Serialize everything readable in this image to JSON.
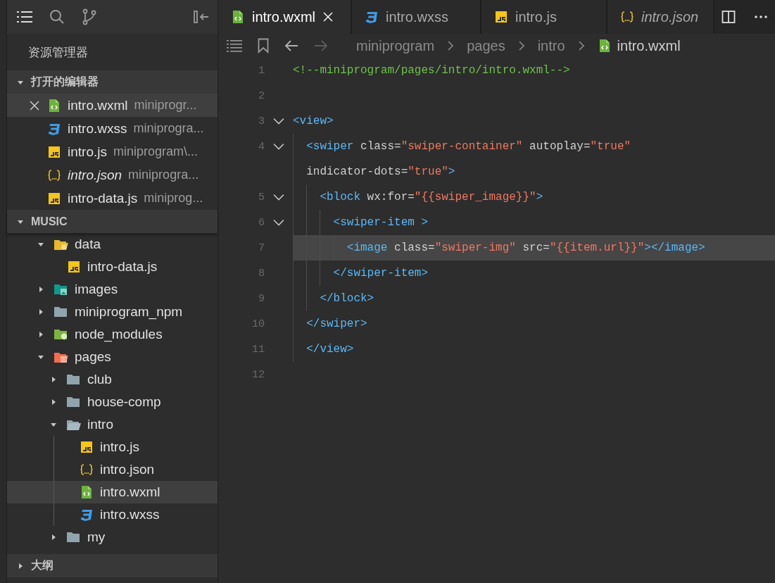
{
  "sidebar": {
    "title": "资源管理器",
    "open_editors": {
      "label": "打开的编辑器",
      "expanded": true,
      "items": [
        {
          "name": "intro.wxml",
          "path": "miniprogr...",
          "kind": "wxml",
          "selected": true,
          "preview": false
        },
        {
          "name": "intro.wxss",
          "path": "miniprogra...",
          "kind": "wxss",
          "selected": false,
          "preview": false
        },
        {
          "name": "intro.js",
          "path": "miniprogram\\...",
          "kind": "js",
          "selected": false,
          "preview": false
        },
        {
          "name": "intro.json",
          "path": "miniprogra...",
          "kind": "json",
          "selected": false,
          "preview": true
        },
        {
          "name": "intro-data.js",
          "path": "miniprog...",
          "kind": "js",
          "selected": false,
          "preview": false
        }
      ]
    },
    "project": {
      "label": "MUSIC",
      "expanded": true,
      "tree": [
        {
          "name": "data",
          "kind": "folder-data",
          "expanded": true,
          "selected": false,
          "children": [
            {
              "name": "intro-data.js",
              "kind": "js",
              "selected": false
            }
          ]
        },
        {
          "name": "images",
          "kind": "folder-images",
          "expanded": false,
          "selected": false
        },
        {
          "name": "miniprogram_npm",
          "kind": "folder",
          "expanded": false,
          "selected": false
        },
        {
          "name": "node_modules",
          "kind": "folder-node",
          "expanded": false,
          "selected": false
        },
        {
          "name": "pages",
          "kind": "folder-pages",
          "expanded": true,
          "selected": false,
          "children": [
            {
              "name": "club",
              "kind": "folder",
              "expanded": false,
              "selected": false
            },
            {
              "name": "house-comp",
              "kind": "folder",
              "expanded": false,
              "selected": false
            },
            {
              "name": "intro",
              "kind": "folder",
              "expanded": true,
              "selected": false,
              "children": [
                {
                  "name": "intro.js",
                  "kind": "js",
                  "selected": false
                },
                {
                  "name": "intro.json",
                  "kind": "json",
                  "selected": false
                },
                {
                  "name": "intro.wxml",
                  "kind": "wxml",
                  "selected": true
                },
                {
                  "name": "intro.wxss",
                  "kind": "wxss",
                  "selected": false
                }
              ]
            },
            {
              "name": "my",
              "kind": "folder",
              "expanded": false,
              "selected": false
            }
          ]
        }
      ]
    },
    "outline": {
      "label": "大纲",
      "expanded": false
    }
  },
  "tabs": [
    {
      "label": "intro.wxml",
      "kind": "wxml",
      "selected": true,
      "preview": false
    },
    {
      "label": "intro.wxss",
      "kind": "wxss",
      "selected": false,
      "preview": false
    },
    {
      "label": "intro.js",
      "kind": "js",
      "selected": false,
      "preview": false
    },
    {
      "label": "intro.json",
      "kind": "json",
      "selected": false,
      "preview": true
    }
  ],
  "breadcrumb": [
    {
      "label": "miniprogram"
    },
    {
      "label": "pages"
    },
    {
      "label": "intro"
    },
    {
      "label": "intro.wxml",
      "kind": "wxml"
    }
  ],
  "code": [
    {
      "number": "1",
      "foldable": false,
      "current": false,
      "tokens": [
        {
          "kind": "comment",
          "text": "<!--miniprogram/pages/intro/intro.wxml-->"
        }
      ]
    },
    {
      "number": "2",
      "foldable": false,
      "current": false
    },
    {
      "number": "3",
      "foldable": true,
      "current": false,
      "tokens": [
        {
          "kind": "tag",
          "text": "<view>"
        }
      ]
    },
    {
      "number": "4",
      "foldable": true,
      "current": false,
      "tokens": [
        {
          "kind": "tag",
          "text": "  <swiper"
        },
        {
          "kind": "attr",
          "text": " class="
        },
        {
          "kind": "string",
          "text": "\"swiper-container\""
        },
        {
          "kind": "attr",
          "text": " autoplay="
        },
        {
          "kind": "string",
          "text": "\"true\""
        }
      ]
    },
    {
      "foldable": false,
      "current": false,
      "tokens": [
        {
          "kind": "attr",
          "text": "  indicator-dots="
        },
        {
          "kind": "string",
          "text": "\"true\""
        },
        {
          "kind": "tag",
          "text": ">"
        }
      ]
    },
    {
      "number": "5",
      "foldable": true,
      "current": false,
      "tokens": [
        {
          "kind": "tag",
          "text": "    <block"
        },
        {
          "kind": "attr",
          "text": " wx:for="
        },
        {
          "kind": "string",
          "text": "\"{{swiper_image}}\""
        },
        {
          "kind": "tag",
          "text": ">"
        }
      ]
    },
    {
      "number": "6",
      "foldable": true,
      "current": false,
      "tokens": [
        {
          "kind": "tag",
          "text": "      <swiper-item >"
        }
      ]
    },
    {
      "number": "7",
      "foldable": false,
      "current": true,
      "tokens": [
        {
          "kind": "tag",
          "text": "        <image"
        },
        {
          "kind": "attr",
          "text": " class="
        },
        {
          "kind": "string",
          "text": "\"swiper-img\""
        },
        {
          "kind": "attr",
          "text": " src="
        },
        {
          "kind": "string",
          "text": "\"{{item.url}}\""
        },
        {
          "kind": "tag",
          "text": "></image>"
        }
      ]
    },
    {
      "number": "8",
      "foldable": false,
      "current": false,
      "tokens": [
        {
          "kind": "tag",
          "text": "      </swiper-item>"
        }
      ]
    },
    {
      "number": "9",
      "foldable": false,
      "current": false,
      "tokens": [
        {
          "kind": "tag",
          "text": "    </block>"
        }
      ]
    },
    {
      "number": "10",
      "foldable": false,
      "current": false,
      "tokens": [
        {
          "kind": "tag",
          "text": "  </swiper>"
        }
      ]
    },
    {
      "number": "11",
      "foldable": false,
      "current": false,
      "tokens": [
        {
          "kind": "tag",
          "text": "  </view>"
        }
      ]
    },
    {
      "number": "12",
      "foldable": false,
      "current": false
    }
  ]
}
